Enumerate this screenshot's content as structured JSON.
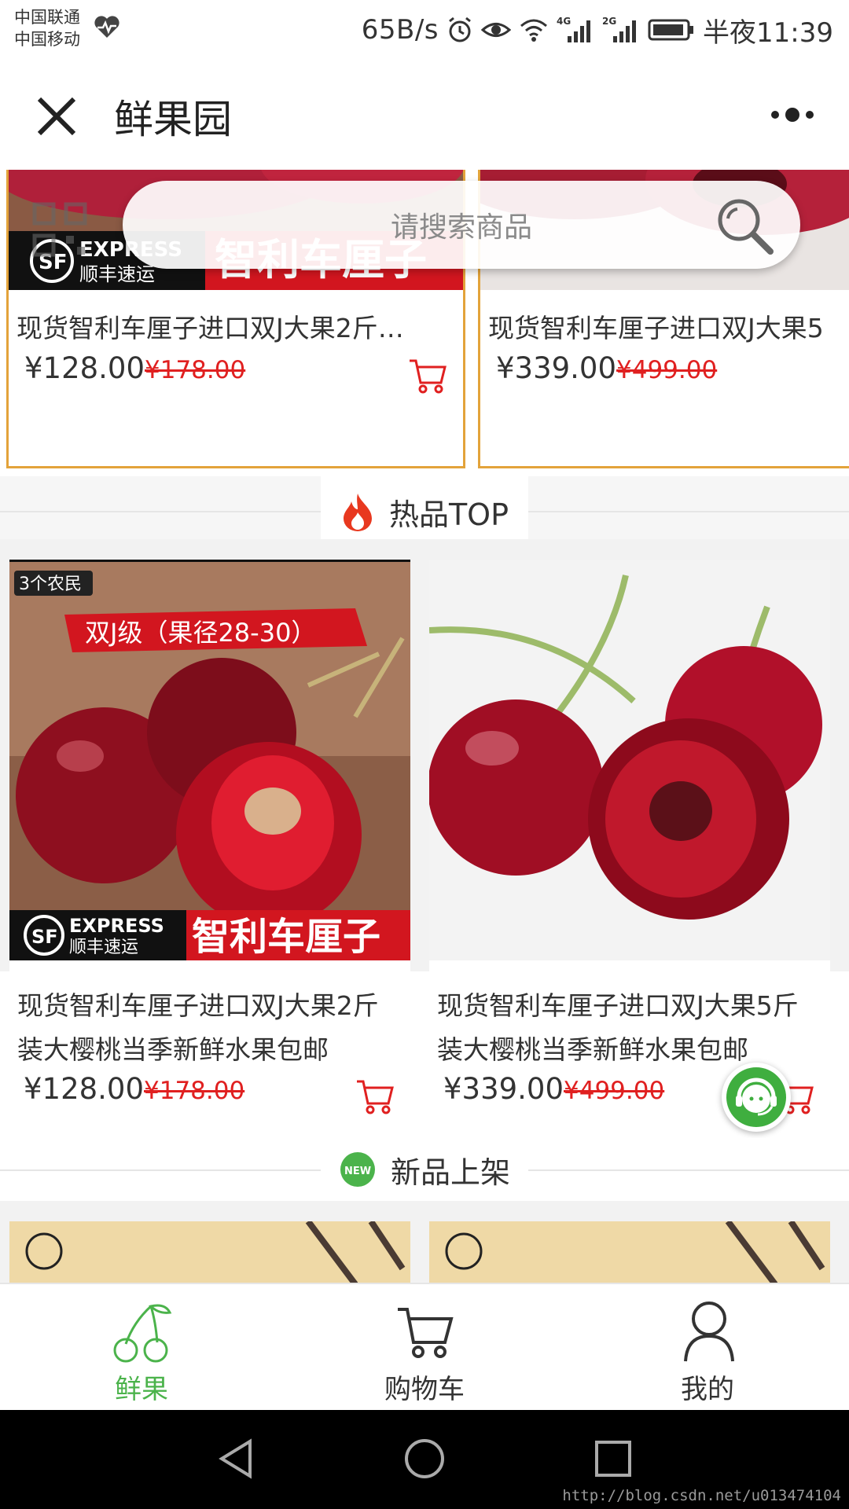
{
  "status_bar": {
    "carrier_1": "中国联通",
    "carrier_2": "中国移动",
    "net_speed": "65B/s",
    "net_4g": "4G",
    "net_2g": "2G",
    "time": "半夜11:39"
  },
  "title_bar": {
    "title": "鲜果园"
  },
  "search": {
    "placeholder": "请搜索商品"
  },
  "featured": {
    "banner_text": "智利车厘子",
    "express_brand": "EXPRESS",
    "express_cn": "顺丰速运",
    "items": [
      {
        "name": "现货智利车厘子进口双J大果2斤…",
        "price": "¥128.00",
        "old_price": "¥178.00"
      },
      {
        "name": "现货智利车厘子进口双J大果5",
        "price": "¥339.00",
        "old_price": "¥499.00"
      }
    ]
  },
  "hot_section": {
    "title": "热品TOP",
    "items": [
      {
        "badge": "3个农民",
        "grade": "双J级（果径28-30）",
        "express_brand": "EXPRESS",
        "express_cn": "顺丰速运",
        "banner_text": "智利车厘子",
        "name": "现货智利车厘子进口双J大果2斤装大樱桃当季新鲜水果包邮",
        "price": "¥128.00",
        "old_price": "¥178.00"
      },
      {
        "name": "现货智利车厘子进口双J大果5斤装大樱桃当季新鲜水果包邮",
        "price": "¥339.00",
        "old_price": "¥499.00"
      }
    ]
  },
  "new_section": {
    "title": "新品上架",
    "badge": "NEW"
  },
  "tab_bar": {
    "tabs": [
      {
        "label": "鲜果",
        "active": true
      },
      {
        "label": "购物车",
        "active": false
      },
      {
        "label": "我的",
        "active": false
      }
    ]
  },
  "watermark": "http://blog.csdn.net/u013474104",
  "colors": {
    "accent_green": "#4bb34b",
    "price_red": "#e02020",
    "card_border": "#e3a33a"
  }
}
